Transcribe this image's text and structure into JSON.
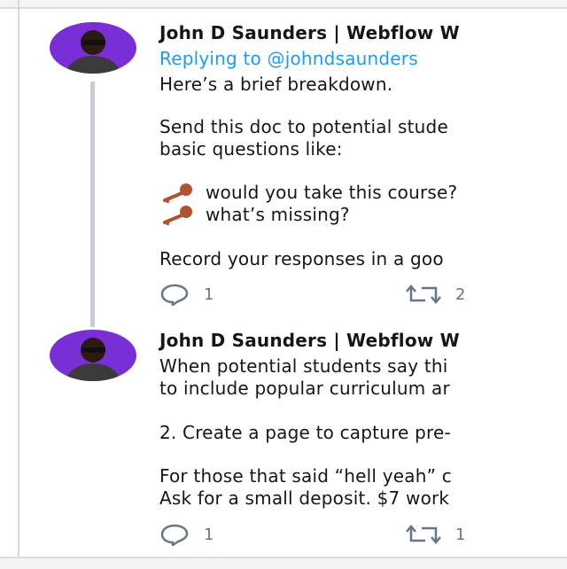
{
  "tweets": [
    {
      "author": "John D Saunders | Webflow W",
      "replying_prefix": "Replying to",
      "replying_handle": "@johndsaunders",
      "lines": [
        "Here’s a brief breakdown.",
        "Send this doc to potential stude",
        "basic questions like:",
        "would you take this course?",
        "what’s missing?",
        "Record your responses in a goo"
      ],
      "reply_count": "1",
      "retweet_count": "2"
    },
    {
      "author": "John D Saunders | Webflow W",
      "lines": [
        "When potential students say thi",
        "to include popular curriculum ar",
        "2. Create a page to capture pre-",
        "For those that said “hell yeah” c",
        "Ask for a small deposit. $7 work"
      ],
      "reply_count": "1",
      "retweet_count": "1"
    }
  ],
  "icons": {
    "avatar_bg": "#7a2fd6",
    "accent": "#1d9bf0",
    "key_color": "#b0532f"
  }
}
